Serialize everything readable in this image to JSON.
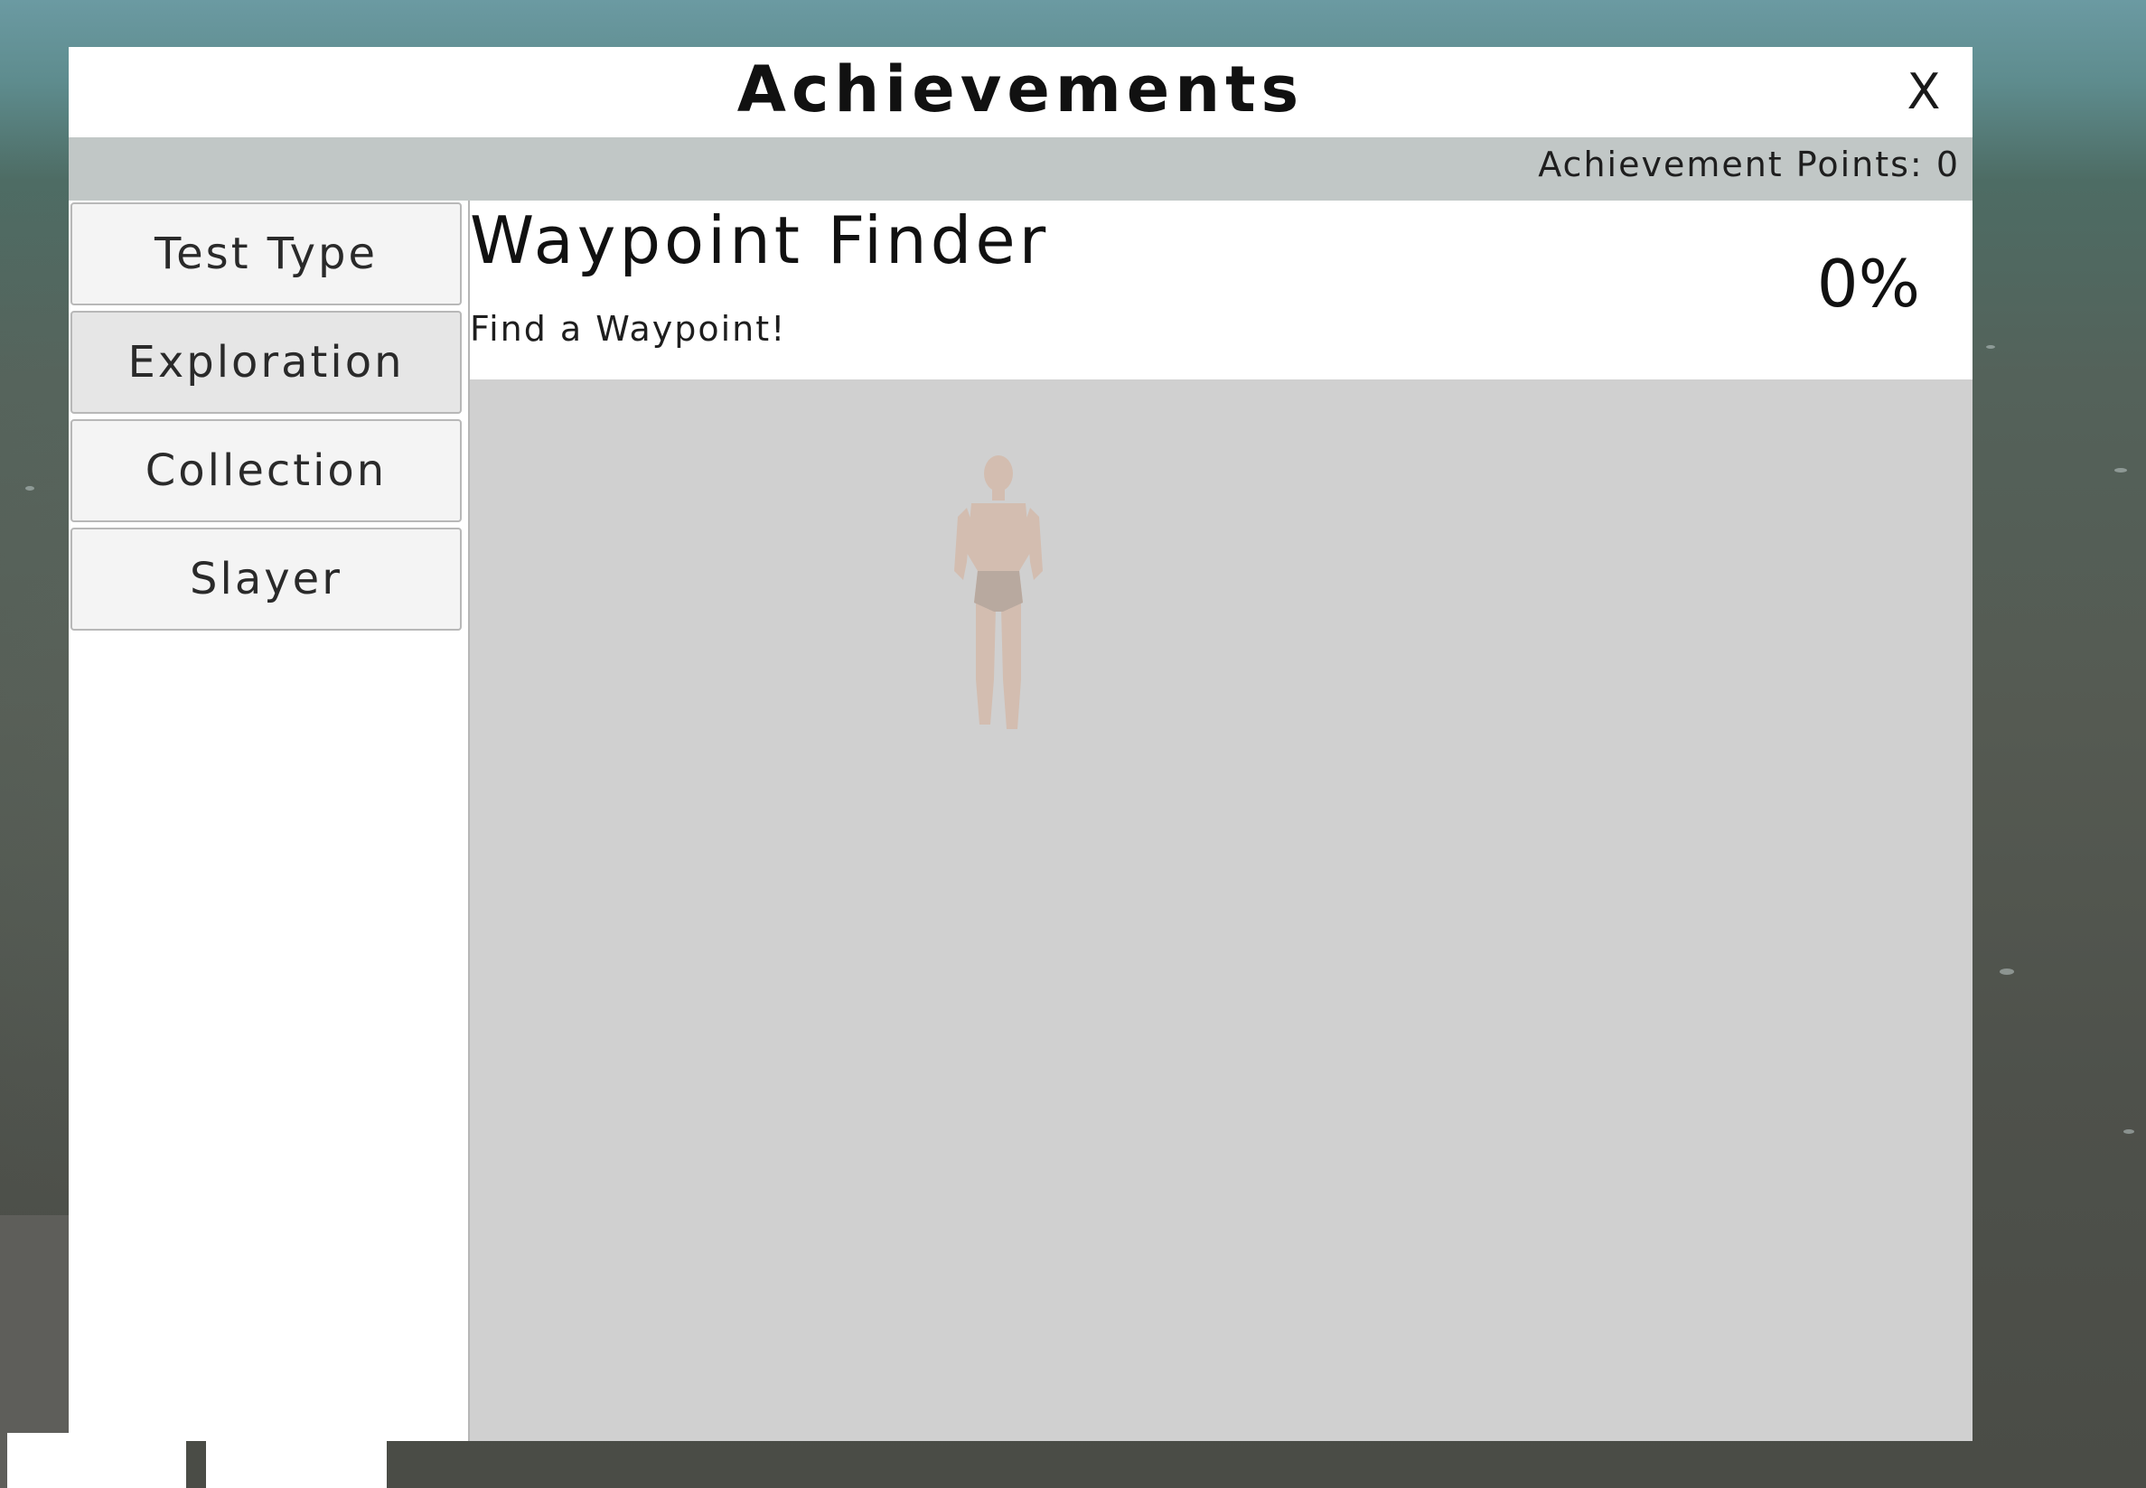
{
  "window": {
    "title": "Achievements",
    "close_label": "X"
  },
  "points_bar": {
    "text": "Achievement Points: 0"
  },
  "categories": [
    {
      "label": "Test Type",
      "active": false
    },
    {
      "label": "Exploration",
      "active": true
    },
    {
      "label": "Collection",
      "active": false
    },
    {
      "label": "Slayer",
      "active": false
    }
  ],
  "achievements": [
    {
      "name": "Waypoint Finder",
      "description": "Find a Waypoint!",
      "progress": "0%"
    }
  ],
  "colors": {
    "window_bg": "#ffffff",
    "points_bar_bg": "#c1c7c6",
    "list_pane_bg": "#cccccc",
    "button_bg": "#f4f4f4",
    "button_active_bg": "#e6e6e6",
    "text": "#111111"
  }
}
